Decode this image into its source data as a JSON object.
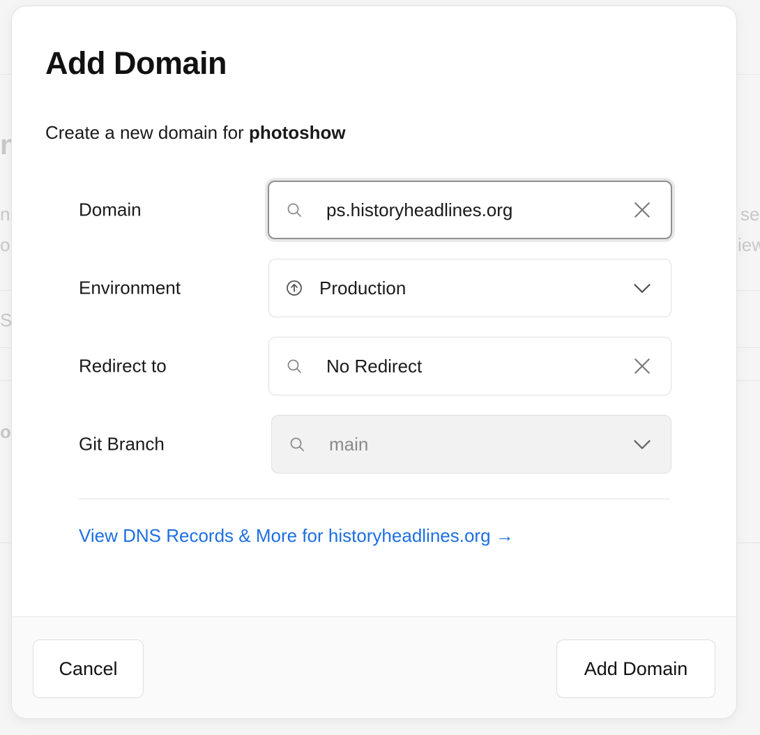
{
  "background": {
    "fragments": [
      "n",
      "ns",
      "on",
      "Se",
      "o",
      "se",
      "iew"
    ]
  },
  "modal": {
    "title": "Add Domain",
    "subtitle_prefix": "Create a new domain for",
    "project_name": "photoshow",
    "fields": {
      "domain": {
        "label": "Domain",
        "value": "ps.historyheadlines.org",
        "lead_icon": "search-icon",
        "trail_icon": "close-icon"
      },
      "environment": {
        "label": "Environment",
        "value": "Production",
        "lead_icon": "arrow-up-circle-icon",
        "trail_icon": "chevron-down-icon"
      },
      "redirect": {
        "label": "Redirect to",
        "value": "No Redirect",
        "lead_icon": "search-icon",
        "trail_icon": "close-icon"
      },
      "git_branch": {
        "label": "Git Branch",
        "value": "main",
        "lead_icon": "search-icon",
        "trail_icon": "chevron-down-icon",
        "disabled": true
      }
    },
    "dns_link": "View DNS Records & More for historyheadlines.org →",
    "footer": {
      "cancel_label": "Cancel",
      "submit_label": "Add Domain"
    }
  },
  "colors": {
    "link": "#1d6fe0",
    "focus_border": "#8f8f8f",
    "disabled_bg": "#f2f2f2"
  }
}
